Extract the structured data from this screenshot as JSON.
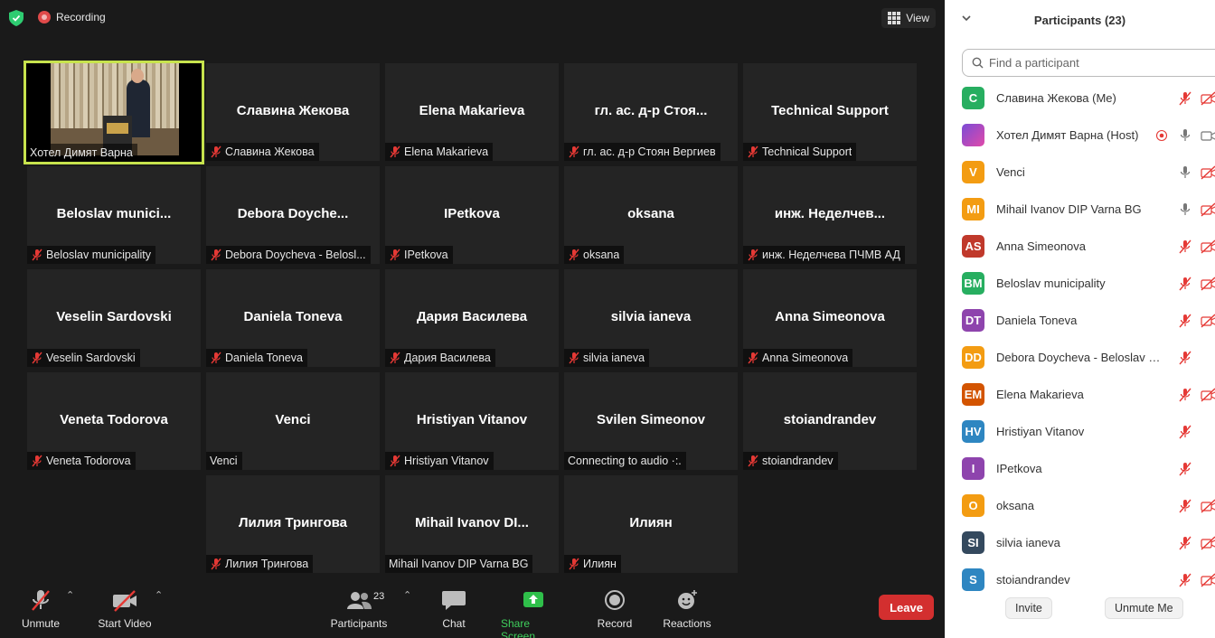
{
  "topbar": {
    "recording_label": "Recording",
    "view_label": "View"
  },
  "host_tile": {
    "label": "Хотел Димят Варна"
  },
  "tiles": [
    {
      "name": "Славина Жекова",
      "label": "Славина Жекова",
      "muted": true
    },
    {
      "name": "Elena Makarieva",
      "label": "Elena Makarieva",
      "muted": true
    },
    {
      "name": "гл. ас. д-р Стоя...",
      "label": "гл. ас. д-р Стоян Вергиев",
      "muted": true
    },
    {
      "name": "Technical Support",
      "label": "Technical Support",
      "muted": true
    },
    {
      "name": "Beloslav  munici...",
      "label": "Beloslav municipality",
      "muted": true
    },
    {
      "name": "Debora  Doyche...",
      "label": "Debora Doycheva -  Belosl...",
      "muted": true
    },
    {
      "name": "IPetkova",
      "label": "IPetkova",
      "muted": true
    },
    {
      "name": "oksana",
      "label": "oksana",
      "muted": true
    },
    {
      "name": "инж.  Неделчев...",
      "label": "инж. Неделчева ПЧМВ АД",
      "muted": true
    },
    {
      "name": "Veselin Sardovski",
      "label": "Veselin Sardovski",
      "muted": true
    },
    {
      "name": "Daniela Toneva",
      "label": "Daniela Toneva",
      "muted": true
    },
    {
      "name": "Дария Василева",
      "label": "Дария Василева",
      "muted": true
    },
    {
      "name": "silvia ianeva",
      "label": "silvia ianeva",
      "muted": true
    },
    {
      "name": "Anna Simeonova",
      "label": "Anna Simeonova",
      "muted": true
    },
    {
      "name": "Veneta Todorova",
      "label": "Veneta Todorova",
      "muted": true
    },
    {
      "name": "Venci",
      "label": "Venci",
      "muted": false
    },
    {
      "name": "Hristiyan Vitanov",
      "label": "Hristiyan Vitanov",
      "muted": true
    },
    {
      "name": "Svilen Simeonov",
      "label": "Connecting to audio  ·:.",
      "muted": false
    },
    {
      "name": "stoiandrandev",
      "label": "stoiandrandev",
      "muted": true
    },
    {
      "name": "Лилия Трингова",
      "label": "Лилия Трингова",
      "muted": true
    },
    {
      "name": "Mihail  Ivanov  DI...",
      "label": "Mihail Ivanov DIP Varna BG",
      "muted": false
    },
    {
      "name": "Илиян",
      "label": "Илиян",
      "muted": true
    }
  ],
  "toolbar": {
    "unmute": "Unmute",
    "start_video": "Start Video",
    "participants": "Participants",
    "participants_count": "23",
    "chat": "Chat",
    "share_screen": "Share Screen",
    "record": "Record",
    "reactions": "Reactions",
    "leave": "Leave"
  },
  "panel": {
    "title": "Participants (23)",
    "search_placeholder": "Find a participant",
    "invite": "Invite",
    "unmute_me": "Unmute Me",
    "participants": [
      {
        "initials": "C",
        "name": "Славина Жекова (Me)",
        "color": "#27ae60",
        "mic": "muted",
        "video": "off"
      },
      {
        "initials": "",
        "name": "Хотел Димят Варна (Host)",
        "color": "#b74bd6",
        "mic": "on",
        "video": "on",
        "recording": true
      },
      {
        "initials": "V",
        "name": "Venci",
        "color": "#f39c12",
        "mic": "on",
        "video": "off"
      },
      {
        "initials": "MI",
        "name": "Mihail Ivanov DIP Varna BG",
        "color": "#f39c12",
        "mic": "on",
        "video": "off"
      },
      {
        "initials": "AS",
        "name": "Anna Simeonova",
        "color": "#c0392b",
        "mic": "muted",
        "video": "off"
      },
      {
        "initials": "BM",
        "name": "Beloslav municipality",
        "color": "#27ae60",
        "mic": "muted",
        "video": "off"
      },
      {
        "initials": "DT",
        "name": "Daniela Toneva",
        "color": "#8e44ad",
        "mic": "muted",
        "video": "off"
      },
      {
        "initials": "DD",
        "name": "Debora Doycheva -  Beloslav Munici...",
        "color": "#f39c12",
        "mic": "muted",
        "video": "none"
      },
      {
        "initials": "EM",
        "name": "Elena Makarieva",
        "color": "#d35400",
        "mic": "muted",
        "video": "off"
      },
      {
        "initials": "HV",
        "name": "Hristiyan Vitanov",
        "color": "#2e86c1",
        "mic": "muted",
        "video": "none"
      },
      {
        "initials": "I",
        "name": "IPetkova",
        "color": "#8e44ad",
        "mic": "muted",
        "video": "none"
      },
      {
        "initials": "O",
        "name": "oksana",
        "color": "#f39c12",
        "mic": "muted",
        "video": "off"
      },
      {
        "initials": "SI",
        "name": "silvia ianeva",
        "color": "#34495e",
        "mic": "muted",
        "video": "off"
      },
      {
        "initials": "S",
        "name": "stoiandrandev",
        "color": "#2e86c1",
        "mic": "muted",
        "video": "off"
      }
    ]
  }
}
